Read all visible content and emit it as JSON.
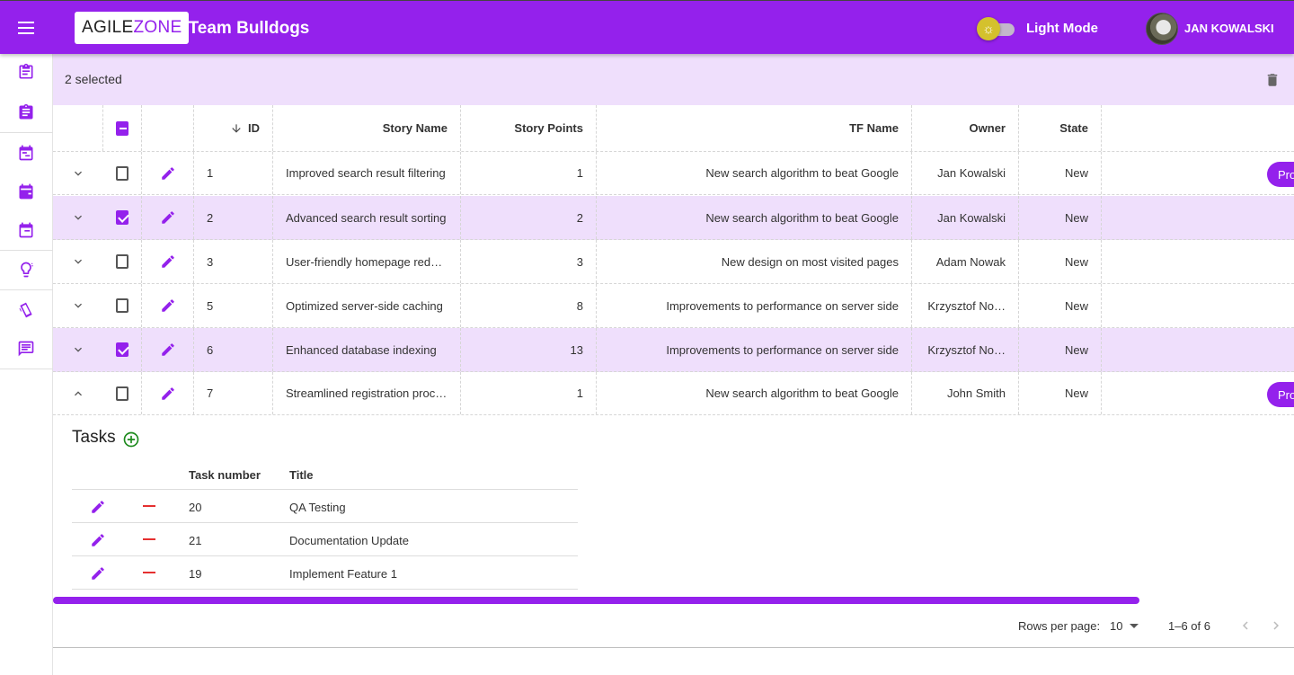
{
  "header": {
    "logo_part1": "AGILE",
    "logo_part2": "ZONE",
    "team": "- Team Bulldogs",
    "mode_label": "Light Mode",
    "user_name": "JAN KOWALSKI"
  },
  "colors": {
    "brand": "#9421ec",
    "selected_row": "#efdffc",
    "delete": "#e53030",
    "add": "#1d8a1d"
  },
  "sidebar": {
    "icons": [
      "clipboard-outline-icon",
      "clipboard-icon",
      "calendar-outline-icon",
      "calendar-icon",
      "calendar-range-icon",
      "lightbulb-icon",
      "tickets-icon",
      "message-icon"
    ]
  },
  "toolbar": {
    "selected_text": "2 selected"
  },
  "table": {
    "columns": {
      "id": "ID",
      "story_name": "Story Name",
      "story_points": "Story Points",
      "tf_name": "TF Name",
      "owner": "Owner",
      "state": "State"
    },
    "rows": [
      {
        "id": "1",
        "story_name": "Improved search result filtering",
        "story_points": "1",
        "tf_name": "New search algorithm to beat Google",
        "owner": "Jan Kowalski",
        "state": "New",
        "checked": false,
        "action": "Pro"
      },
      {
        "id": "2",
        "story_name": "Advanced search result sorting",
        "story_points": "2",
        "tf_name": "New search algorithm to beat Google",
        "owner": "Jan Kowalski",
        "state": "New",
        "checked": true,
        "action": ""
      },
      {
        "id": "3",
        "story_name": "User-friendly homepage redes…",
        "story_points": "3",
        "tf_name": "New design on most visited pages",
        "owner": "Adam Nowak",
        "state": "New",
        "checked": false,
        "action": ""
      },
      {
        "id": "5",
        "story_name": "Optimized server-side caching",
        "story_points": "8",
        "tf_name": "Improvements to performance on server side",
        "owner": "Krzysztof No…",
        "state": "New",
        "checked": false,
        "action": ""
      },
      {
        "id": "6",
        "story_name": "Enhanced database indexing",
        "story_points": "13",
        "tf_name": "Improvements to performance on server side",
        "owner": "Krzysztof No…",
        "state": "New",
        "checked": true,
        "action": ""
      },
      {
        "id": "7",
        "story_name": "Streamlined registration proc…",
        "story_points": "1",
        "tf_name": "New search algorithm to beat Google",
        "owner": "John Smith",
        "state": "New",
        "checked": false,
        "action": "Pro"
      }
    ]
  },
  "tasks": {
    "title": "Tasks",
    "col_number": "Task number",
    "col_title": "Title",
    "rows": [
      {
        "number": "20",
        "title": "QA Testing"
      },
      {
        "number": "21",
        "title": "Documentation Update"
      },
      {
        "number": "19",
        "title": "Implement Feature 1"
      }
    ]
  },
  "pagination": {
    "rows_per_page_label": "Rows per page:",
    "rows_per_page": "10",
    "range": "1–6 of 6"
  }
}
